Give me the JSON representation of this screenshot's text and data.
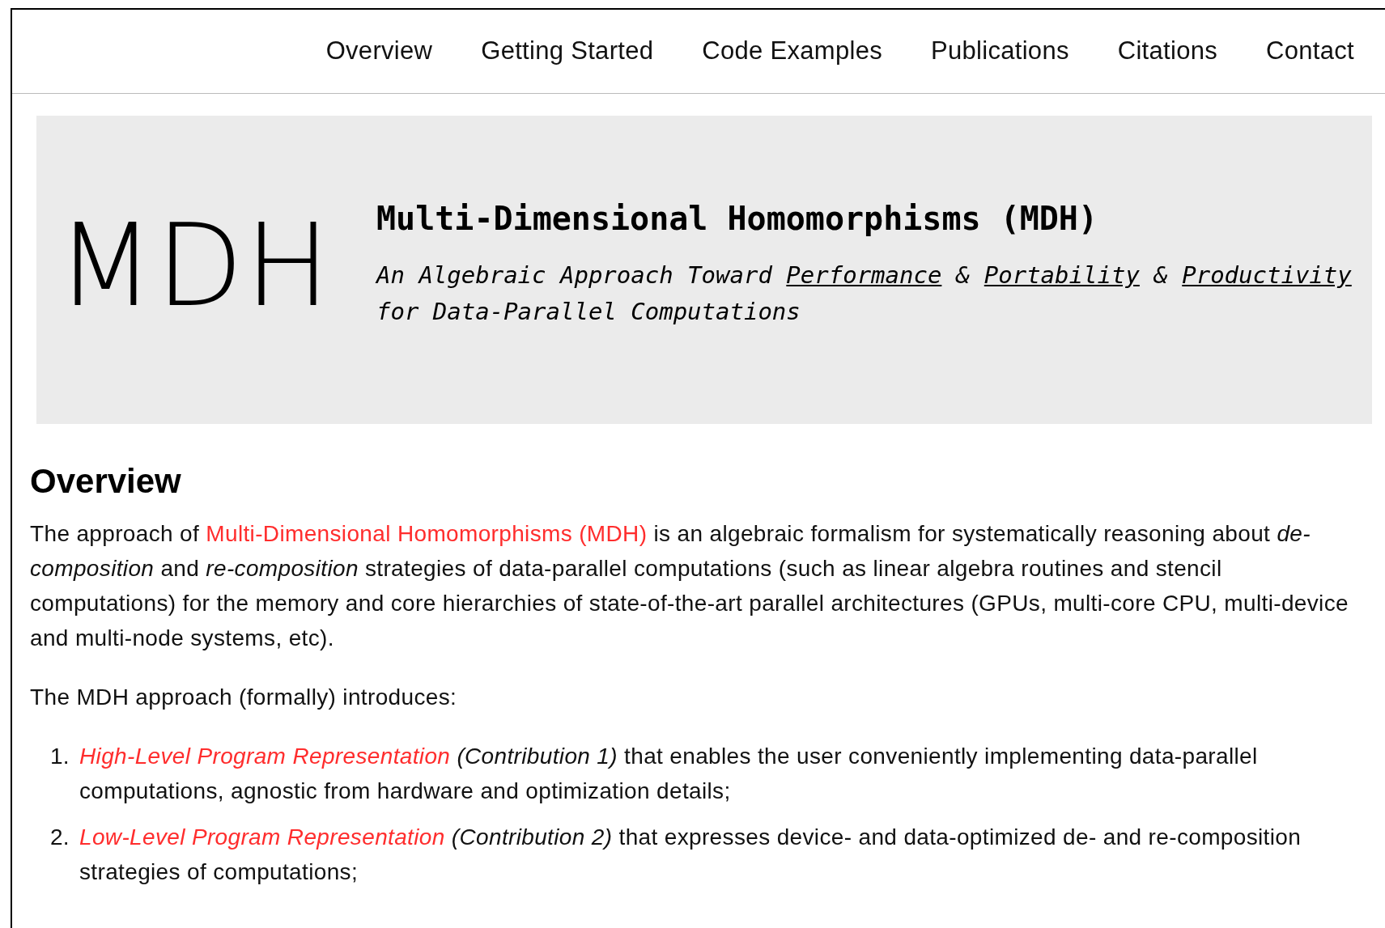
{
  "nav": {
    "items": [
      {
        "label": "Overview"
      },
      {
        "label": "Getting Started"
      },
      {
        "label": "Code Examples"
      },
      {
        "label": "Publications"
      },
      {
        "label": "Citations"
      },
      {
        "label": "Contact"
      }
    ]
  },
  "banner": {
    "logo": "MDH",
    "title": "Multi-Dimensional Homomorphisms (MDH)",
    "subtitle": [
      {
        "text": "An Algebraic Approach Toward ",
        "link": false
      },
      {
        "text": "Performance",
        "link": true
      },
      {
        "text": " & ",
        "link": false
      },
      {
        "text": "Portability",
        "link": true
      },
      {
        "text": " & ",
        "link": false
      },
      {
        "text": "Productivity",
        "link": true
      },
      {
        "text": " for Data-Parallel Computations",
        "link": false
      }
    ]
  },
  "overview": {
    "heading": "Overview",
    "intro": {
      "before": "The approach of ",
      "link": "Multi-Dimensional Homomorphisms (MDH)",
      "after": " is an algebraic formalism for systematically reasoning about *de-composition* and *re-composition* strategies of data-parallel computations (such as linear algebra routines and stencil computations) for the memory and core hierarchies of state-of-the-art parallel architectures (GPUs, multi-core CPU, multi-device and multi-node systems, etc)."
    },
    "lead": "The MDH approach (formally) introduces:",
    "list": [
      {
        "number": "1.",
        "link": "High-Level Program Representation",
        "rest": "*(Contribution 1)* that enables the user conveniently implementing data-parallel computations, agnostic from hardware and optimization details;"
      },
      {
        "number": "2.",
        "link": "Low-Level Program Representation",
        "rest": "*(Contribution 2)* that expresses device- and data-optimized de- and re-composition strategies of computations;"
      }
    ]
  }
}
